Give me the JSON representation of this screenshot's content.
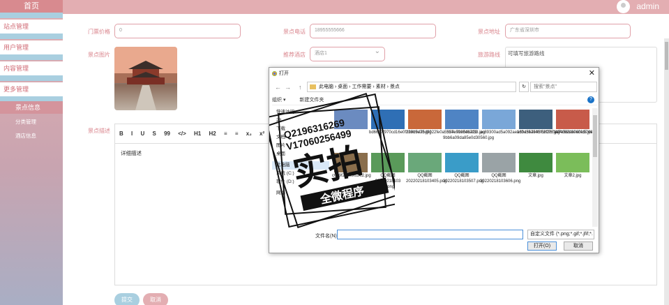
{
  "sidebar": {
    "home": "首页",
    "menus": [
      "站点管理",
      "用户管理",
      "内容管理",
      "更多管理"
    ],
    "active_sub": "景点信息",
    "subs": [
      "分类管理",
      "酒店信息"
    ]
  },
  "header": {
    "user": "admin"
  },
  "form": {
    "price_label": "门票价格",
    "price_value": "0",
    "phone_label": "景点电话",
    "phone_value": "18955555666",
    "address_label": "景点地址",
    "address_value": "广东省深圳市",
    "image_label": "景点图片",
    "hotel_label": "推荐酒店",
    "hotel_value": "酒店1",
    "route_label": "旅游路线",
    "route_value": "可填写旅游路线",
    "desc_label": "景点描述",
    "desc_value": "详细描述",
    "submit": "提交",
    "cancel": "取消"
  },
  "editor": {
    "tools": [
      "B",
      "I",
      "U",
      "S",
      "99",
      "</>",
      "H1",
      "H2",
      "≡",
      "≡",
      "x₂",
      "x²",
      "⊡"
    ]
  },
  "dialog": {
    "title": "打开",
    "breadcrumb": [
      "此电脑",
      "桌面",
      "工作需要",
      "素材",
      "景点"
    ],
    "search_placeholder": "搜索\"景点\"",
    "organize": "组织 ▾",
    "new_folder": "新建文件夹",
    "tree": [
      "快速访问",
      "23",
      "下载",
      "文档",
      "图片",
      "桌面",
      "此电脑",
      "系统 (C:)",
      "软件 (D:)",
      "网络"
    ],
    "files": [
      {
        "name": "",
        "color": "#6b8bc0"
      },
      {
        "name": "bd6637f970cd16e0f2b9b5e75.jpg",
        "color": "#2f6fb5"
      },
      {
        "name": "128d9d3bd9022fe0a5324e7bedd1af33.jpg",
        "color": "#c9683a"
      },
      {
        "name": "557e923546723 9bb6a09da85e0d30560.jpg",
        "color": "#4f84c4"
      },
      {
        "name": "ac89300ad5a092ae160a5e7505f56076.jpg",
        "color": "#7aa7d8"
      },
      {
        "name": "adbd35ae4bfc2f267f424062a696bfc5.jpeg",
        "color": "#3d5f7d"
      },
      {
        "name": "ae7e566fa0a0e97465e4c6d072374a87.jpg",
        "color": "#c85b4a"
      },
      {
        "name": "c059f268e962fc2.jpg",
        "color": "#8a6e4c"
      },
      {
        "name": "QQ截图20220218103 49.png",
        "color": "#5a9a5a"
      },
      {
        "name": "QQ截图20220218103405.png",
        "color": "#6aa87a"
      },
      {
        "name": "QQ截图20220218103507.png",
        "color": "#3a9cc8"
      },
      {
        "name": "QQ截图20220218103606.png",
        "color": "#9aa3a6"
      },
      {
        "name": "文章.jpg",
        "color": "#3f8a3f"
      },
      {
        "name": "文章2.jpg",
        "color": "#7bbd5a"
      }
    ],
    "filename_label": "文件名(N):",
    "filetype": "自定义文件 (*.png;*.gif;*.jfif;*.",
    "open": "打开(O)",
    "cancel": "取消"
  },
  "watermark": {
    "phone1": "Q2196316269",
    "phone2": "V17060256499",
    "big": "实拍",
    "band": "全微程序"
  }
}
